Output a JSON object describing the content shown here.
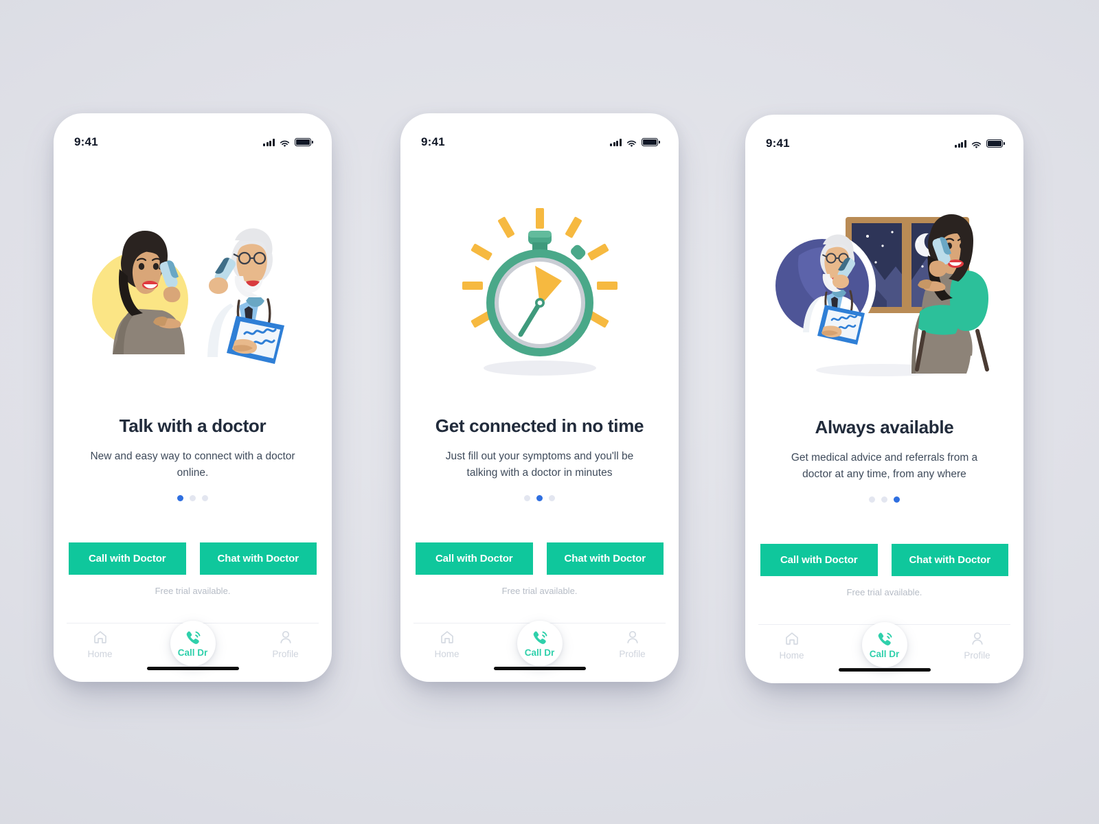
{
  "theme": {
    "background": "#dfe0e7",
    "card": "#ffffff",
    "accent_green": "#0fc79c",
    "accent_teal": "#2fd0ab",
    "title_color": "#212b3b",
    "subtitle_color": "#3f4b5b",
    "dot_active": "#2f6fe0",
    "dot_inactive": "#e3e6f0",
    "muted_text": "#b6bcc6",
    "nav_label": "#cfd4dd"
  },
  "status_bar": {
    "time": "9:41",
    "icons": [
      "signal-bars-icon",
      "wifi-icon",
      "battery-icon"
    ]
  },
  "buttons": {
    "call_label": "Call with Doctor",
    "chat_label": "Chat with Doctor",
    "free_trial": "Free trial available."
  },
  "bottom_nav": {
    "items": [
      {
        "label": "Home",
        "icon": "home-icon"
      },
      {
        "label": "Call Dr",
        "icon": "phone-call-icon"
      },
      {
        "label": "Profile",
        "icon": "person-icon"
      }
    ]
  },
  "screens": [
    {
      "id": "talk-with-a-doctor",
      "illustration": "woman-on-phone-and-doctor-with-clipboard",
      "title": "Talk with a doctor",
      "subtitle": "New and easy way to connect with a doctor online.",
      "active_dot": 0,
      "dot_count": 3
    },
    {
      "id": "get-connected-in-no-time",
      "illustration": "stopwatch",
      "title": "Get connected in no time",
      "subtitle": "Just fill out your symptoms and you'll be talking with a doctor in minutes",
      "active_dot": 1,
      "dot_count": 3
    },
    {
      "id": "always-available",
      "illustration": "doctor-badge-night-window-seated-woman",
      "title": "Always available",
      "subtitle": "Get medical advice and referrals from a doctor at any time, from any where",
      "active_dot": 2,
      "dot_count": 3
    }
  ]
}
